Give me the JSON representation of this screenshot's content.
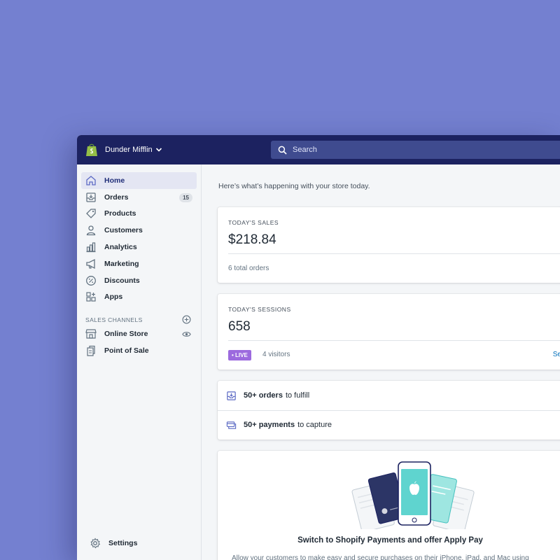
{
  "topbar": {
    "store_name": "Dunder Mifflin",
    "search_placeholder": "Search"
  },
  "sidebar": {
    "items": [
      {
        "label": "Home",
        "icon": "home-icon",
        "active": true
      },
      {
        "label": "Orders",
        "icon": "orders-icon",
        "badge": "15"
      },
      {
        "label": "Products",
        "icon": "tag-icon"
      },
      {
        "label": "Customers",
        "icon": "person-icon"
      },
      {
        "label": "Analytics",
        "icon": "bar-chart-icon"
      },
      {
        "label": "Marketing",
        "icon": "megaphone-icon"
      },
      {
        "label": "Discounts",
        "icon": "discount-icon"
      },
      {
        "label": "Apps",
        "icon": "apps-icon"
      }
    ],
    "channels_heading": "SALES CHANNELS",
    "channels": [
      {
        "label": "Online Store",
        "icon": "storefront-icon"
      },
      {
        "label": "Point of Sale",
        "icon": "pos-icon"
      }
    ],
    "settings_label": "Settings"
  },
  "main": {
    "greeting": "Here’s what’s happening with your store today.",
    "sales": {
      "label": "TODAY'S SALES",
      "value": "$218.84",
      "sub": "6 total orders"
    },
    "sessions": {
      "label": "TODAY'S SESSIONS",
      "value": "658",
      "live_badge": "• LIVE",
      "visitors": "4 visitors",
      "see_link": "Se"
    },
    "tasks": [
      {
        "bold": "50+ orders",
        "rest": "to fulfill"
      },
      {
        "bold": "50+ payments",
        "rest": "to capture"
      }
    ],
    "promo": {
      "title": "Switch to Shopify Payments and offer Apply Pay",
      "text": "Allow your customers to make easy and secure purchases on their iPhone, iPad, and Mac using"
    }
  },
  "colors": {
    "background": "#7480d0",
    "topbar": "#1c2260",
    "accent": "#5c6ac4",
    "live": "#9c6ade"
  }
}
